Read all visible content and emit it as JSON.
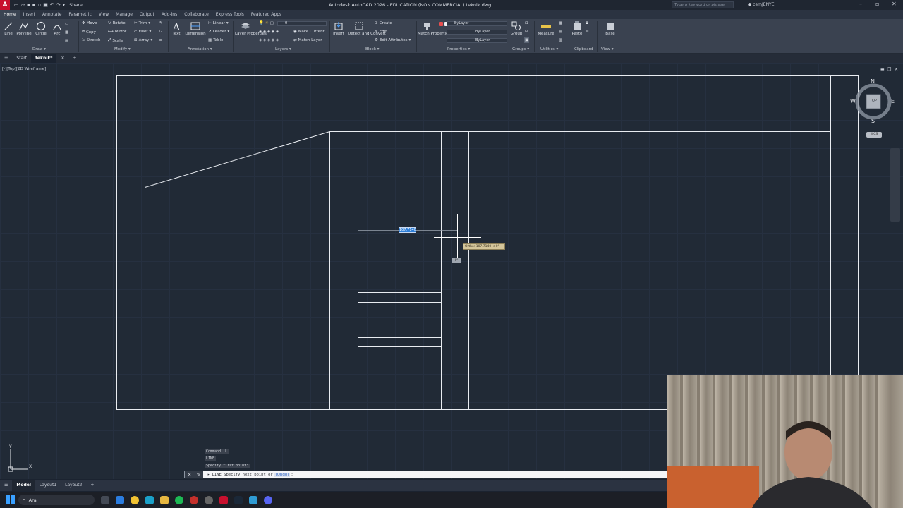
{
  "titlebar": {
    "app_logo": "A",
    "share": "Share",
    "title": "Autodesk AutoCAD 2026 - EDUCATION (NON COMMERCIAL)   teknik.dwg",
    "search_placeholder": "Type a keyword or phrase",
    "user": "cemJENYE"
  },
  "ribbon_tabs": [
    "Home",
    "Insert",
    "Annotate",
    "Parametric",
    "View",
    "Manage",
    "Output",
    "Add-ins",
    "Collaborate",
    "Express Tools",
    "Featured Apps"
  ],
  "ribbon": {
    "draw": {
      "label": "Draw",
      "line": "Line",
      "polyline": "Polyline",
      "circle": "Circle",
      "arc": "Arc"
    },
    "modify": {
      "label": "Modify",
      "move": "Move",
      "rotate": "Rotate",
      "trim": "Trim",
      "copy": "Copy",
      "mirror": "Mirror",
      "fillet": "Fillet",
      "stretch": "Stretch",
      "scale": "Scale",
      "array": "Array"
    },
    "annotation": {
      "label": "Annotation",
      "text": "Text",
      "dimension": "Dimension",
      "linear": "Linear",
      "leader": "Leader",
      "table": "Table"
    },
    "layers": {
      "label": "Layers",
      "layer_properties": "Layer Properties",
      "layer_value": "0",
      "make_current": "Make Current",
      "match_layer": "Match Layer"
    },
    "block": {
      "label": "Block",
      "insert": "Insert",
      "detect_convert": "Detect and Convert",
      "create": "Create",
      "edit": "Edit",
      "edit_attributes": "Edit Attributes"
    },
    "properties": {
      "label": "Properties",
      "match_properties": "Match Properties",
      "bylayer_1": "ByLayer",
      "bylayer_2": "ByLayer",
      "bylayer_3": "ByLayer"
    },
    "groups": {
      "label": "Groups",
      "group": "Group"
    },
    "utilities": {
      "label": "Utilities",
      "measure": "Measure"
    },
    "clipboard": {
      "label": "Clipboard",
      "paste": "Paste"
    },
    "view": {
      "label": "View",
      "base": "Base"
    }
  },
  "file_tabs": {
    "start": "Start",
    "current": "teknik*"
  },
  "viewport": {
    "label": "[-][Top][2D Wireframe]"
  },
  "dynamic_input": {
    "value": "107.7140",
    "ortho_tip": "Ortho: 107.7140 < 0°",
    "snap": "0°"
  },
  "viewcube": {
    "n": "N",
    "s": "S",
    "e": "E",
    "w": "W",
    "top": "TOP",
    "wcs": "WCS"
  },
  "command": {
    "history": [
      "Command: L",
      "LINE",
      "Specify first point:"
    ],
    "prompt": "LINE Specify next point or",
    "option": "Undo"
  },
  "ucs": {
    "x": "X",
    "y": "Y"
  },
  "layout_tabs": [
    "Model",
    "Layout1",
    "Layout2"
  ],
  "taskbar": {
    "search_label": "Ara"
  },
  "colors": {
    "canvas": "#212a36",
    "ribbon": "#3a4250",
    "accent": "#2f7fd8",
    "logo": "#c8102e"
  }
}
